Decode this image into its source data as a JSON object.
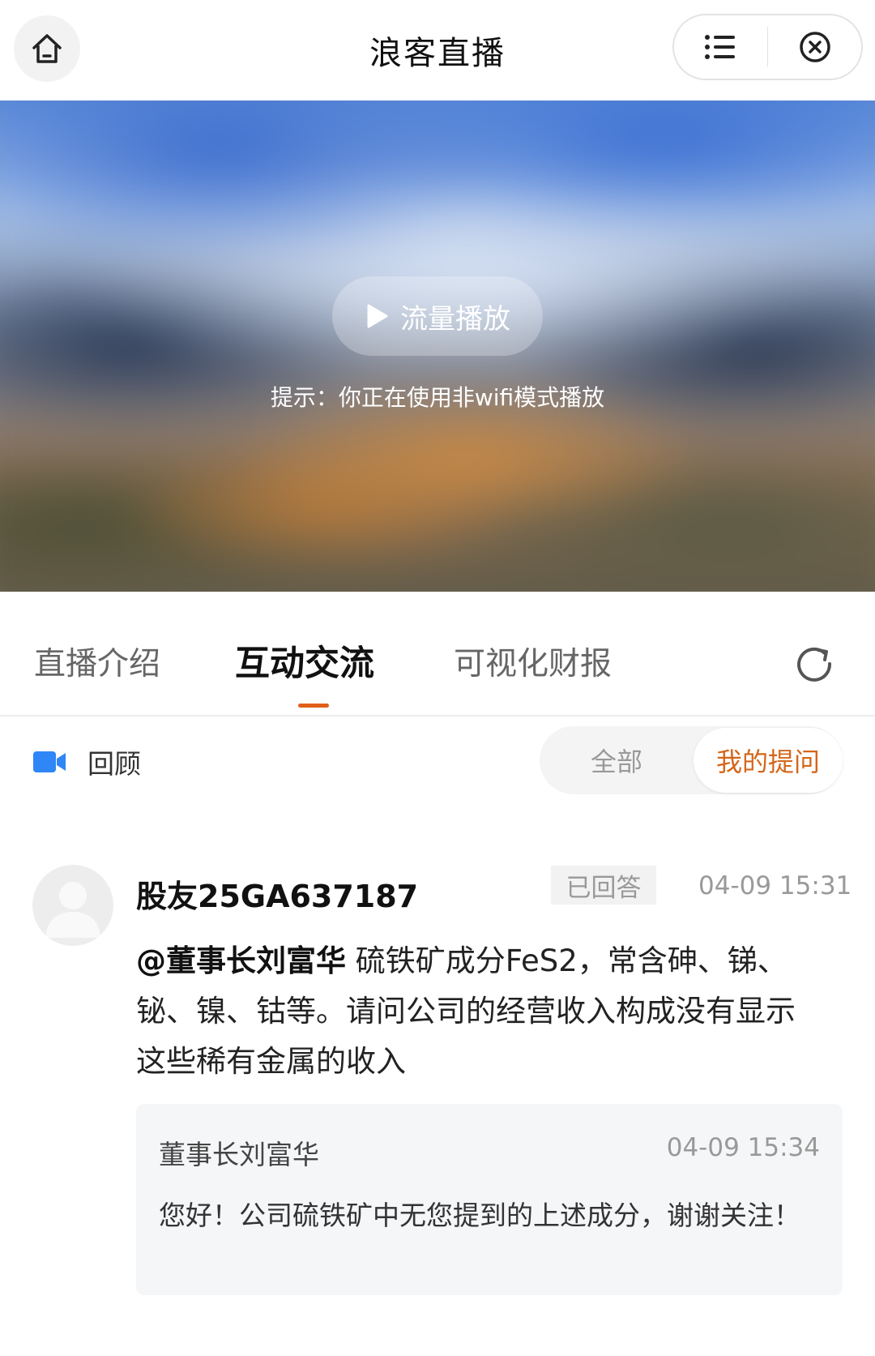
{
  "header": {
    "title": "浪客直播",
    "icons": {
      "home": "home-icon",
      "menu": "list-menu-icon",
      "close": "close-circle-icon"
    }
  },
  "video": {
    "play_label": "流量播放",
    "hint": "提示：你正在使用非wifi模式播放"
  },
  "tabs": [
    {
      "label": "直播介绍",
      "active": false
    },
    {
      "label": "互动交流",
      "active": true
    },
    {
      "label": "可视化财报",
      "active": false
    }
  ],
  "filter": {
    "review_label": "回顾",
    "options": [
      {
        "label": "全部",
        "selected": false
      },
      {
        "label": "我的提问",
        "selected": true
      }
    ]
  },
  "question": {
    "user": "股友25GA637187",
    "status": "已回答",
    "time": "04-09 15:31",
    "mention": "@董事长刘富华",
    "text": " 硫铁矿成分FeS2，常含砷、锑、铋、镍、钴等。请问公司的经营收入构成没有显示这些稀有金属的收入",
    "answer": {
      "name": "董事长刘富华",
      "time": "04-09 15:34",
      "text": "您好！公司硫铁矿中无您提到的上述成分，谢谢关注！"
    }
  },
  "colors": {
    "accent": "#e05f19",
    "selected_text": "#d4661a",
    "video_icon": "#2f86f6"
  }
}
